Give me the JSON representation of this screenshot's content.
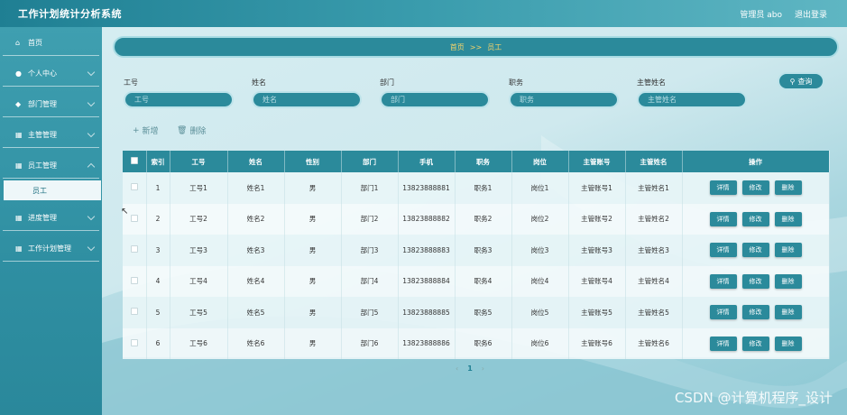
{
  "header": {
    "app_title": "工作计划统计分析系统",
    "user": "管理员 abo",
    "logout": "退出登录"
  },
  "sidebar": {
    "items": [
      {
        "label": "首页",
        "icon": "home-icon",
        "glyph": "⌂"
      },
      {
        "label": "个人中心",
        "icon": "user-icon",
        "glyph": "●"
      },
      {
        "label": "部门管理",
        "icon": "location-icon",
        "glyph": "◆"
      },
      {
        "label": "主管管理",
        "icon": "grid-icon",
        "glyph": "▦"
      },
      {
        "label": "员工管理",
        "icon": "grid-icon",
        "glyph": "▦"
      },
      {
        "label": "进度管理",
        "icon": "grid-icon",
        "glyph": "▦"
      },
      {
        "label": "工作计划管理",
        "icon": "grid-icon",
        "glyph": "▦"
      }
    ],
    "active_sub": "员工"
  },
  "breadcrumb": {
    "home": "首页",
    "sep": ">>",
    "current": "员工"
  },
  "filters": {
    "fields": [
      {
        "label": "工号",
        "placeholder": "工号"
      },
      {
        "label": "姓名",
        "placeholder": "姓名"
      },
      {
        "label": "部门",
        "placeholder": "部门"
      },
      {
        "label": "职务",
        "placeholder": "职务"
      },
      {
        "label": "主管姓名",
        "placeholder": "主管姓名"
      }
    ],
    "search_label": "查询"
  },
  "actions": {
    "add": "新增",
    "delete": "删除"
  },
  "table": {
    "columns": [
      "索引",
      "工号",
      "姓名",
      "性别",
      "部门",
      "手机",
      "职务",
      "岗位",
      "主管账号",
      "主管姓名",
      "操作"
    ],
    "rows": [
      [
        "1",
        "工号1",
        "姓名1",
        "男",
        "部门1",
        "13823888881",
        "职务1",
        "岗位1",
        "主管账号1",
        "主管姓名1"
      ],
      [
        "2",
        "工号2",
        "姓名2",
        "男",
        "部门2",
        "13823888882",
        "职务2",
        "岗位2",
        "主管账号2",
        "主管姓名2"
      ],
      [
        "3",
        "工号3",
        "姓名3",
        "男",
        "部门3",
        "13823888883",
        "职务3",
        "岗位3",
        "主管账号3",
        "主管姓名3"
      ],
      [
        "4",
        "工号4",
        "姓名4",
        "男",
        "部门4",
        "13823888884",
        "职务4",
        "岗位4",
        "主管账号4",
        "主管姓名4"
      ],
      [
        "5",
        "工号5",
        "姓名5",
        "男",
        "部门5",
        "13823888885",
        "职务5",
        "岗位5",
        "主管账号5",
        "主管姓名5"
      ],
      [
        "6",
        "工号6",
        "姓名6",
        "男",
        "部门6",
        "13823888886",
        "职务6",
        "岗位6",
        "主管账号6",
        "主管姓名6"
      ]
    ],
    "row_actions": [
      "详情",
      "修改",
      "删除"
    ]
  },
  "pager": {
    "prev": "‹",
    "page": "1",
    "next": "›"
  },
  "watermark": "CSDN @计算机程序_设计",
  "colors": {
    "primary": "#2b8a9b",
    "header_bg": "#1f7f93",
    "breadcrumb_text": "#f5d46a"
  }
}
